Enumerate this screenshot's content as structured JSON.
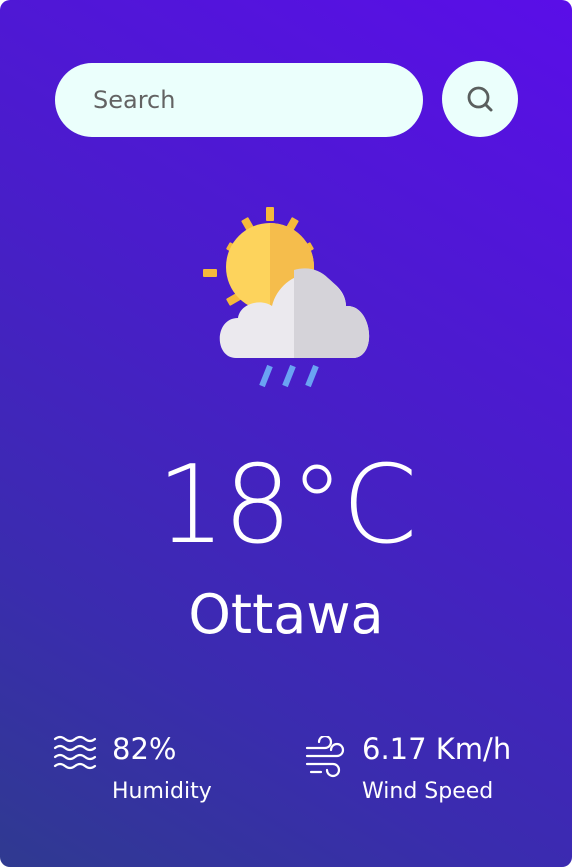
{
  "search": {
    "placeholder": "Search",
    "value": "",
    "button_icon": "search-icon"
  },
  "weather": {
    "icon": "sun-cloud-rain-icon",
    "temperature": "18°C",
    "city": "Ottawa"
  },
  "details": {
    "humidity": {
      "icon": "humidity-waves-icon",
      "value": "82%",
      "label": "Humidity"
    },
    "wind": {
      "icon": "wind-icon",
      "value": "6.17 Km/h",
      "label": "Wind Speed"
    }
  },
  "colors": {
    "gradient_top": "#5a0ee8",
    "gradient_bottom": "#2f3a90",
    "search_bg": "#ebfffc",
    "text": "#ffffff"
  }
}
